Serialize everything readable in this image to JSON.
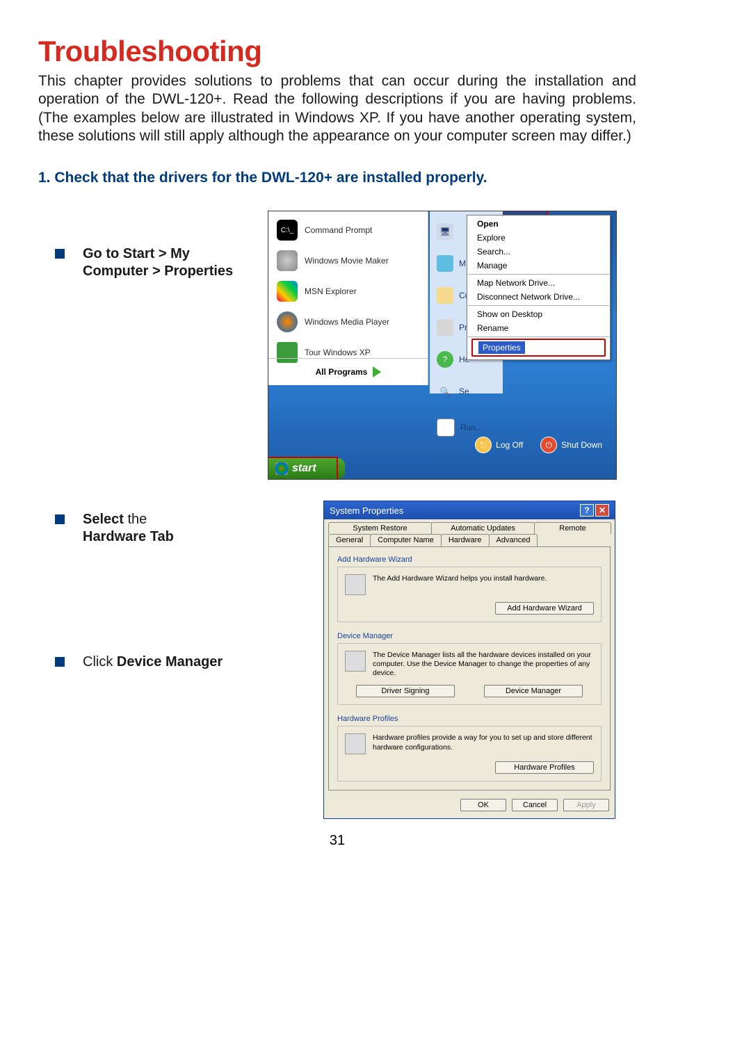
{
  "heading": "Troubleshooting",
  "intro": "This chapter provides solutions to problems that can occur during the installation and operation of the DWL-120+.  Read the following descriptions if you are having problems. (The examples below are illustrated in Windows XP.  If you have another operating system, these solutions will still apply although the appearance on your computer screen may differ.)",
  "step1_title": "1.  Check that the drivers for the DWL-120+ are  installed properly.",
  "bullets": {
    "goto": {
      "pre": "Go to",
      "bold": " Start > My Computer > Properties"
    },
    "select": {
      "pre": "Select",
      "post": " the",
      "bold": "Hardware Tab"
    },
    "click": {
      "pre": "Click ",
      "bold": "Device Manager"
    }
  },
  "start_menu": {
    "left": [
      {
        "label": "Command Prompt",
        "icon": "cmd"
      },
      {
        "label": "Windows Movie Maker",
        "icon": "movie"
      },
      {
        "label": "MSN Explorer",
        "icon": "msn"
      },
      {
        "label": "Windows Media Player",
        "icon": "wmp"
      },
      {
        "label": "Tour Windows XP",
        "icon": "tour"
      }
    ],
    "all_programs": "All Programs",
    "right": [
      {
        "label": "My Computer",
        "icon": "pc"
      },
      {
        "label": "M",
        "icon": "net"
      },
      {
        "label": "Co",
        "icon": "panel"
      },
      {
        "label": "Pr",
        "icon": "printer"
      },
      {
        "label": "He",
        "icon": "help"
      },
      {
        "label": "Se",
        "icon": "search"
      },
      {
        "label": "Run...",
        "icon": "run"
      }
    ],
    "context": [
      "Open",
      "Explore",
      "Search...",
      "Manage",
      "—",
      "Map Network Drive...",
      "Disconnect Network Drive...",
      "—",
      "Show on Desktop",
      "Rename",
      "—",
      "Properties"
    ],
    "log_off": "Log Off",
    "shut_down": "Shut Down",
    "start": "start"
  },
  "sysprops": {
    "title": "System Properties",
    "tabs_top": [
      "System Restore",
      "Automatic Updates",
      "Remote"
    ],
    "tabs_bottom": [
      "General",
      "Computer Name",
      "Hardware",
      "Advanced"
    ],
    "group1_title": "Add Hardware Wizard",
    "group1_desc": "The Add Hardware Wizard helps you install hardware.",
    "group1_btn": "Add Hardware Wizard",
    "group2_title": "Device Manager",
    "group2_desc": "The Device Manager lists all the hardware devices installed on your computer. Use the Device Manager to change the properties of any device.",
    "group2_btn1": "Driver Signing",
    "group2_btn2": "Device Manager",
    "group3_title": "Hardware Profiles",
    "group3_desc": "Hardware profiles provide a way for you to set up and store different hardware configurations.",
    "group3_btn": "Hardware Profiles",
    "ok": "OK",
    "cancel": "Cancel",
    "apply": "Apply"
  },
  "page_number": "31"
}
